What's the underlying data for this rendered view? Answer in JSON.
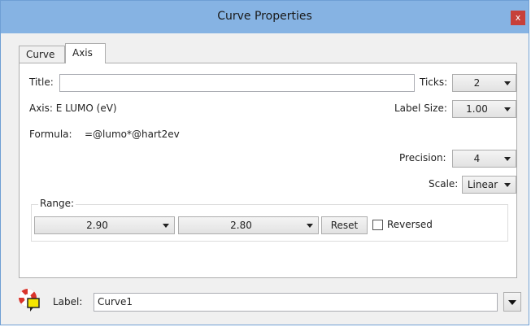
{
  "window": {
    "title": "Curve Properties",
    "close_label": "x"
  },
  "tabs": [
    {
      "label": "Curve"
    },
    {
      "label": "Axis"
    }
  ],
  "axis_tab": {
    "title_label": "Title:",
    "title_value": "",
    "axis_text": "Axis: E LUMO (eV)",
    "formula_label": "Formula:",
    "formula_value": "=@lumo*@hart2ev",
    "ticks_label": "Ticks:",
    "ticks_value": "2",
    "label_size_label": "Label Size:",
    "label_size_value": "1.00",
    "precision_label": "Precision:",
    "precision_value": "4",
    "scale_label": "Scale:",
    "scale_value": "Linear",
    "range": {
      "legend": "Range:",
      "min_value": "2.90",
      "max_value": "2.80",
      "reset_label": "Reset",
      "reversed_label": "Reversed",
      "reversed_checked": false
    }
  },
  "footer": {
    "label_caption": "Label:",
    "label_value": "Curve1"
  },
  "colors": {
    "titlebar": "#86b3e3",
    "close": "#c7403a",
    "icon_red": "#d9342b",
    "icon_yellow": "#f5e600"
  }
}
